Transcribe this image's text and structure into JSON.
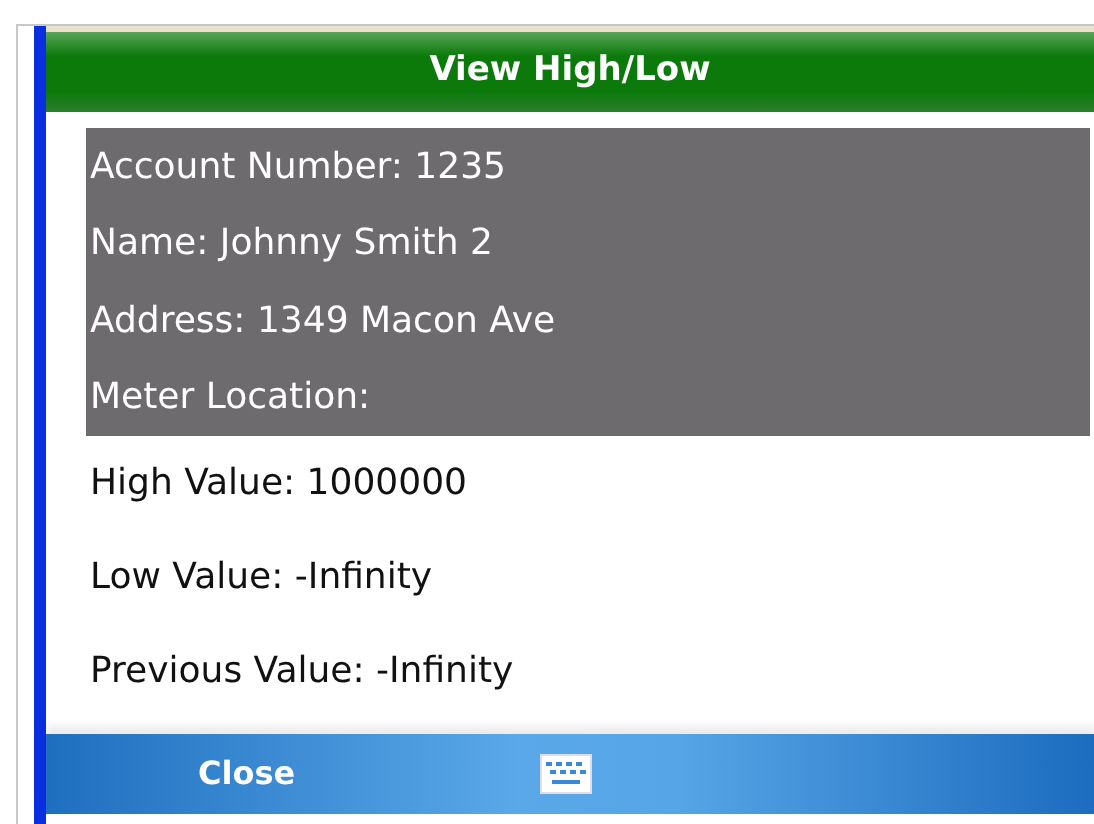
{
  "title": "View High/Low",
  "account_info": [
    "Account Number: 1235",
    "Name: Johnny Smith 2",
    "Address: 1349 Macon Ave",
    "Meter Location:"
  ],
  "values": [
    "High Value: 1000000",
    "Low Value: -Infinity",
    "Previous Value: -Infinity"
  ],
  "menu_bar": {
    "left_button": "Close"
  }
}
